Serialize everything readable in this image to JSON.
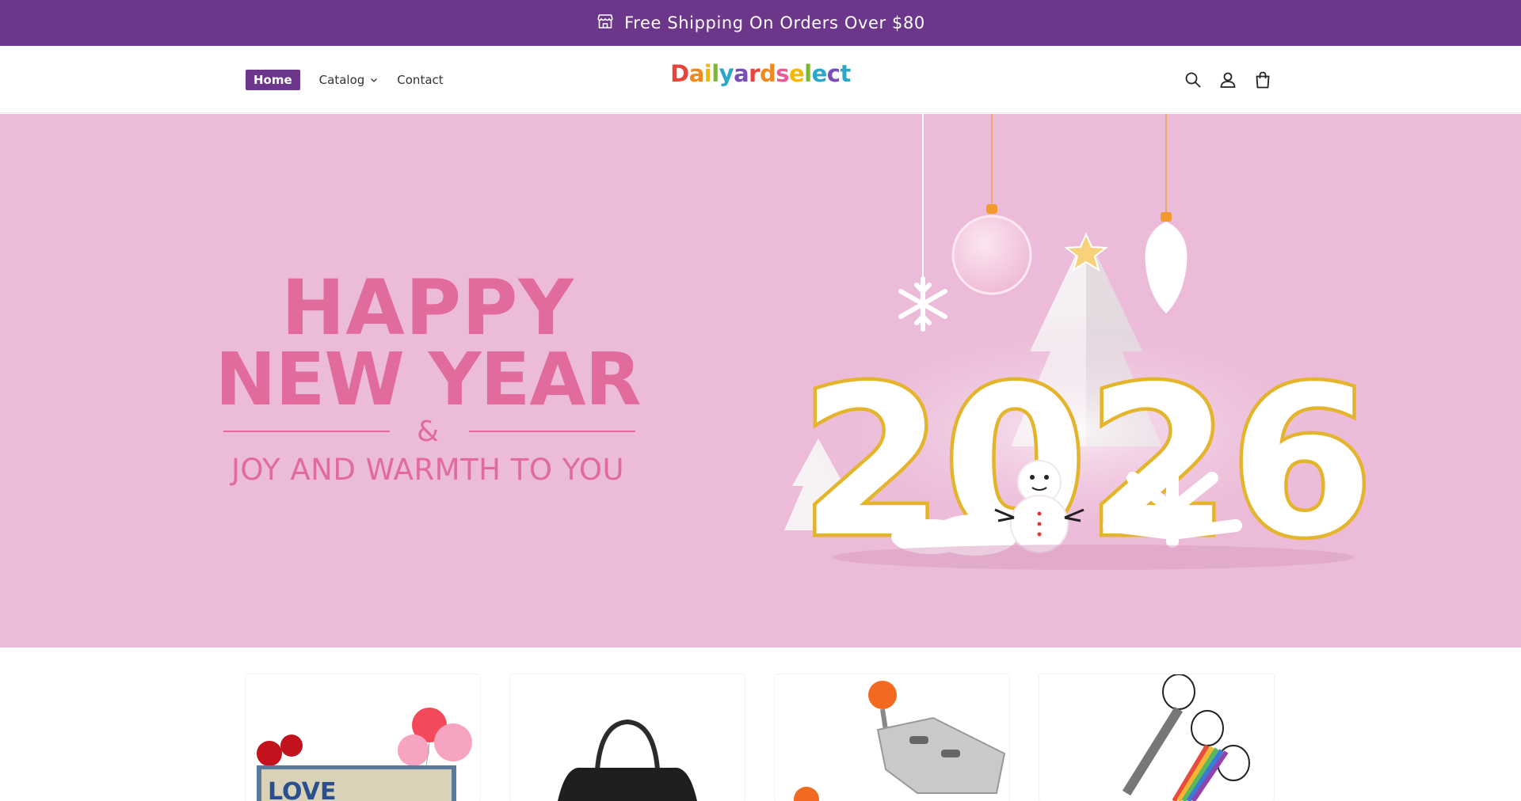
{
  "announcement": {
    "text": "Free Shipping On Orders Over $80",
    "icon": "store-icon"
  },
  "nav": {
    "home_label": "Home",
    "catalog_label": "Catalog",
    "contact_label": "Contact"
  },
  "logo": {
    "letters": [
      "D",
      "a",
      "i",
      "l",
      "y",
      "a",
      "r",
      "d",
      "s",
      "e",
      "l",
      "e",
      "c",
      "t"
    ]
  },
  "header_icons": [
    "search-icon",
    "account-icon",
    "cart-icon"
  ],
  "hero": {
    "line1": "HAPPY",
    "line2": "NEW YEAR",
    "ampersand": "&",
    "line3": "JOY AND WARMTH TO YOU",
    "year": "2026"
  },
  "colors": {
    "brand_purple": "#6c378b",
    "hero_bg": "#ecbbd9",
    "hero_text": "#e06b9c",
    "gold": "#e4b42c"
  },
  "products": [
    {
      "name_icon": "license-plate-sign-image"
    },
    {
      "name_icon": "black-handbag-image"
    },
    {
      "name_icon": "corner-clamp-image"
    },
    {
      "name_icon": "hanging-strap-image"
    }
  ]
}
